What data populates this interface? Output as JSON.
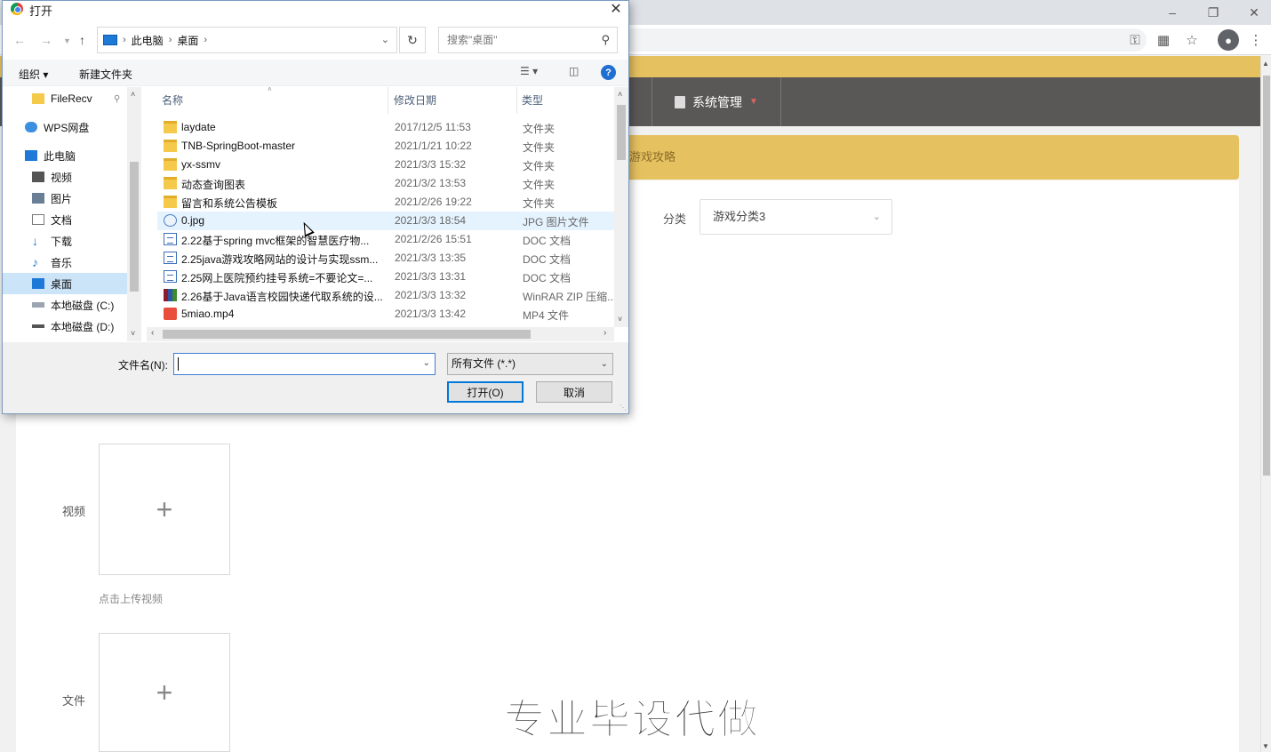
{
  "dialog": {
    "title": "打开",
    "address": {
      "segments": [
        "此电脑",
        "桌面"
      ]
    },
    "search_placeholder": "搜索\"桌面\"",
    "organize_label": "组织 ▾",
    "new_folder_label": "新建文件夹",
    "nav_items": [
      {
        "label": "FileRecv",
        "icon": "folder-icon"
      },
      {
        "label": "WPS网盘",
        "icon": "cloud-icon"
      },
      {
        "label": "此电脑",
        "icon": "computer-icon"
      },
      {
        "label": "视频",
        "icon": "video-icon"
      },
      {
        "label": "图片",
        "icon": "picture-icon"
      },
      {
        "label": "文档",
        "icon": "document-icon"
      },
      {
        "label": "下载",
        "icon": "download-icon"
      },
      {
        "label": "音乐",
        "icon": "music-icon"
      },
      {
        "label": "桌面",
        "icon": "desktop-icon",
        "selected": true
      },
      {
        "label": "本地磁盘 (C:)",
        "icon": "drive-icon"
      },
      {
        "label": "本地磁盘 (D:)",
        "icon": "drive-icon"
      }
    ],
    "columns": {
      "name": "名称",
      "date": "修改日期",
      "type": "类型"
    },
    "files": [
      {
        "name": "laydate",
        "date": "2017/12/5 11:53",
        "type": "文件夹",
        "kind": "folder"
      },
      {
        "name": "TNB-SpringBoot-master",
        "date": "2021/1/21 10:22",
        "type": "文件夹",
        "kind": "folder"
      },
      {
        "name": "yx-ssmv",
        "date": "2021/3/3 15:32",
        "type": "文件夹",
        "kind": "folder"
      },
      {
        "name": "动态查询图表",
        "date": "2021/3/2 13:53",
        "type": "文件夹",
        "kind": "folder"
      },
      {
        "name": "留言和系统公告模板",
        "date": "2021/2/26 19:22",
        "type": "文件夹",
        "kind": "folder"
      },
      {
        "name": "0.jpg",
        "date": "2021/3/3 18:54",
        "type": "JPG 图片文件",
        "kind": "jpg"
      },
      {
        "name": "2.22基于spring mvc框架的智慧医疗物...",
        "date": "2021/2/26 15:51",
        "type": "DOC 文档",
        "kind": "doc"
      },
      {
        "name": "2.25java游戏攻略网站的设计与实现ssm...",
        "date": "2021/3/3 13:35",
        "type": "DOC 文档",
        "kind": "doc"
      },
      {
        "name": "2.25网上医院预约挂号系统=不要论文=...",
        "date": "2021/3/3 13:31",
        "type": "DOC 文档",
        "kind": "doc"
      },
      {
        "name": "2.26基于Java语言校园快递代取系统的设...",
        "date": "2021/3/3 13:32",
        "type": "WinRAR ZIP 压缩...",
        "kind": "zip"
      },
      {
        "name": "5miao.mp4",
        "date": "2021/3/3 13:42",
        "type": "MP4 文件",
        "kind": "mp4"
      }
    ],
    "filename_label": "文件名(N):",
    "filename_value": "",
    "filetype_value": "所有文件 (*.*)",
    "open_label": "打开(O)",
    "cancel_label": "取消"
  },
  "page": {
    "nav_item": "系统管理",
    "breadcrumb": "游戏攻略",
    "category_label": "分类",
    "category_value": "游戏分类3",
    "video_label": "视频",
    "video_hint": "点击上传视频",
    "file_label": "文件",
    "watermark": "专业毕设代做",
    "colors": {
      "band": "#e6c160",
      "nav": "#5a5857"
    }
  }
}
